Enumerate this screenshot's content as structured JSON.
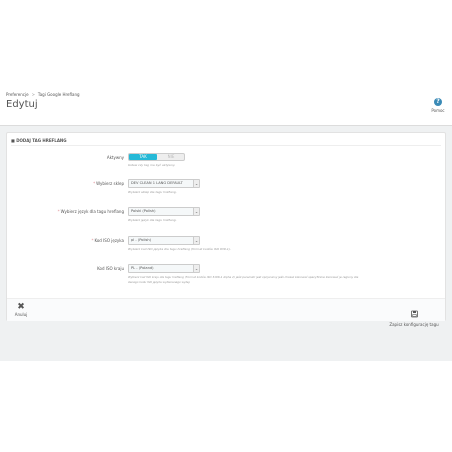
{
  "breadcrumb": {
    "item1": "Preferencje",
    "separator": ">",
    "item2": "Tagi Google Hreflang"
  },
  "page": {
    "title": "Edytuj"
  },
  "toolbar": {
    "help_label": "Pomoc",
    "help_glyph": "?"
  },
  "panel": {
    "heading": "DODAJ TAG HREFLANG",
    "fields": {
      "active": {
        "label": "Aktywny",
        "yes": "TAK",
        "no": "NIE",
        "value": "TAK",
        "help": "Ustaw czy tag ma być aktywny."
      },
      "shop": {
        "label": "Wybierz sklep",
        "value": "DEV CLEAN 1 LANG DEFAULT",
        "help": "Wybierz sklep dla tagu hreflang."
      },
      "language": {
        "label": "Wybierz język dla tagu hreflang",
        "value": "Polski (Polish)",
        "help": "Wybierz język dla tagu hreflang."
      },
      "iso_language": {
        "label": "Kod ISO języka",
        "value": "pl - (Polish)",
        "help": "Wybierz kod ISO języka dla tagu hreflang (format kodów ISO 639-1)."
      },
      "iso_country": {
        "label": "Kod ISO kraju",
        "value": "PL - (Poland)",
        "help_line1": "Wybierz kod ISO kraju dla tagu hreflang (Format kodów ISO 3166-1 Alpha 2) jeśli parametr jest opcjonalny jeśli chcesz kierować specyficzne kierować je regiony dla",
        "help_line2": "danego kodu ISO języka wybieranego wyżej."
      }
    },
    "footer": {
      "cancel_label": "Anuluj",
      "save_label": "Zapisz konfigurację tagu"
    }
  },
  "colors": {
    "accent": "#25b9d7",
    "help_icon": "#3a8ab6",
    "required": "#e08f95"
  },
  "icons": {
    "help": "help-circle-icon",
    "cancel": "close-icon",
    "save": "save-icon",
    "select": "chevron-down-icon"
  }
}
